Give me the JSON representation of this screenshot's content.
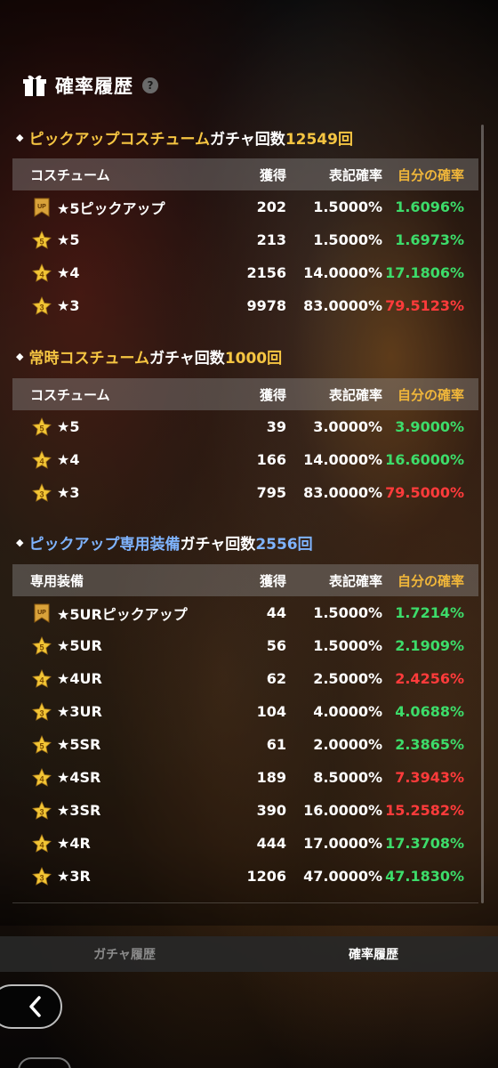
{
  "title": "確率履歴",
  "help_label": "?",
  "sections": [
    {
      "title_a": "ピックアップコスチューム",
      "title_b": "ガチャ回数",
      "title_count": "12549回",
      "headers": [
        "コスチューム",
        "獲得",
        "表記確率",
        "自分の確率"
      ],
      "rows": [
        {
          "badge": "UP",
          "name": "★5ピックアップ",
          "got": "202",
          "rate": "1.5000%",
          "mine": "1.6096%",
          "mine_color": "green"
        },
        {
          "badge": "5",
          "name": "★5",
          "got": "213",
          "rate": "1.5000%",
          "mine": "1.6973%",
          "mine_color": "green"
        },
        {
          "badge": "4",
          "name": "★4",
          "got": "2156",
          "rate": "14.0000%",
          "mine": "17.1806%",
          "mine_color": "green"
        },
        {
          "badge": "3",
          "name": "★3",
          "got": "9978",
          "rate": "83.0000%",
          "mine": "79.5123%",
          "mine_color": "red"
        }
      ]
    },
    {
      "title_a": "常時コスチューム",
      "title_b": "ガチャ回数",
      "title_count": "1000回",
      "headers": [
        "コスチューム",
        "獲得",
        "表記確率",
        "自分の確率"
      ],
      "rows": [
        {
          "badge": "5",
          "name": "★5",
          "got": "39",
          "rate": "3.0000%",
          "mine": "3.9000%",
          "mine_color": "green"
        },
        {
          "badge": "4",
          "name": "★4",
          "got": "166",
          "rate": "14.0000%",
          "mine": "16.6000%",
          "mine_color": "green"
        },
        {
          "badge": "3",
          "name": "★3",
          "got": "795",
          "rate": "83.0000%",
          "mine": "79.5000%",
          "mine_color": "red"
        }
      ]
    },
    {
      "title_a": "ピックアップ専用装備",
      "title_b": "ガチャ回数",
      "title_count": "2556回",
      "headers": [
        "専用装備",
        "獲得",
        "表記確率",
        "自分の確率"
      ],
      "rows": [
        {
          "badge": "UP",
          "name": "★5URピックアップ",
          "got": "44",
          "rate": "1.5000%",
          "mine": "1.7214%",
          "mine_color": "green"
        },
        {
          "badge": "5",
          "name": "★5UR",
          "got": "56",
          "rate": "1.5000%",
          "mine": "2.1909%",
          "mine_color": "green"
        },
        {
          "badge": "4",
          "name": "★4UR",
          "got": "62",
          "rate": "2.5000%",
          "mine": "2.4256%",
          "mine_color": "red"
        },
        {
          "badge": "3",
          "name": "★3UR",
          "got": "104",
          "rate": "4.0000%",
          "mine": "4.0688%",
          "mine_color": "green"
        },
        {
          "badge": "5",
          "name": "★5SR",
          "got": "61",
          "rate": "2.0000%",
          "mine": "2.3865%",
          "mine_color": "green"
        },
        {
          "badge": "4",
          "name": "★4SR",
          "got": "189",
          "rate": "8.5000%",
          "mine": "7.3943%",
          "mine_color": "red"
        },
        {
          "badge": "3",
          "name": "★3SR",
          "got": "390",
          "rate": "16.0000%",
          "mine": "15.2582%",
          "mine_color": "red"
        },
        {
          "badge": "4",
          "name": "★4R",
          "got": "444",
          "rate": "17.0000%",
          "mine": "17.3708%",
          "mine_color": "green"
        },
        {
          "badge": "3",
          "name": "★3R",
          "got": "1206",
          "rate": "47.0000%",
          "mine": "47.1830%",
          "mine_color": "green"
        }
      ]
    }
  ],
  "tabs": {
    "gacha_history": "ガチャ履歴",
    "rate_history": "確率履歴"
  },
  "colors": {
    "gold": "#f0b63a",
    "green": "#3ddc6a",
    "red": "#ff3b3b",
    "section_gold": "#f5c542",
    "section_blue": "#7fb4ff"
  }
}
